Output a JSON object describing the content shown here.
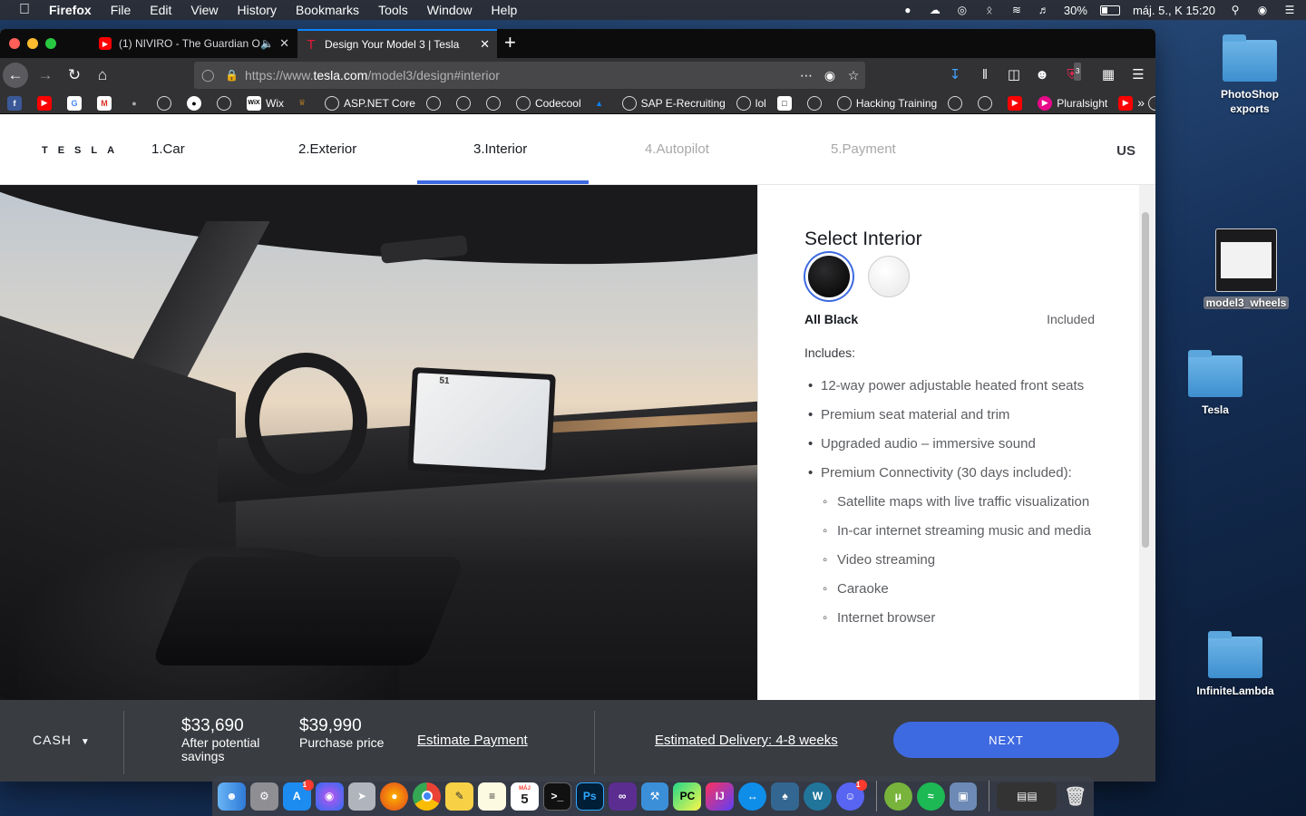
{
  "menubar": {
    "app": "Firefox",
    "menus": [
      "File",
      "Edit",
      "View",
      "History",
      "Bookmarks",
      "Tools",
      "Window",
      "Help"
    ],
    "battery": "30%",
    "datetime": "máj. 5., K  15:20"
  },
  "browser": {
    "tabs": [
      {
        "title": "(1) NIVIRO - The Guardian O",
        "favicon": "youtube-icon",
        "active": false
      },
      {
        "title": "Design Your Model 3 | Tesla",
        "favicon": "tesla-icon",
        "active": true
      }
    ],
    "url_prefix": "https://www.",
    "url_domain": "tesla.com",
    "url_path": "/model3/design#interior",
    "extension_badge": "3",
    "bookmarks": [
      "Wix",
      "ASP.NET Core",
      "Codecool",
      "SAP E-Recruiting",
      "lol",
      "Hacking Training",
      "Pluralsight"
    ]
  },
  "tesla": {
    "logo": "TESLA",
    "steps": [
      {
        "num": "1.",
        "label": "Car"
      },
      {
        "num": "2.",
        "label": "Exterior"
      },
      {
        "num": "3.",
        "label": "Interior"
      },
      {
        "num": "4.",
        "label": "Autopilot"
      },
      {
        "num": "5.",
        "label": "Payment"
      }
    ],
    "active_step": 3,
    "region": "US",
    "photo_speed": "51",
    "interior": {
      "title": "Select Interior",
      "swatches": [
        {
          "name": "All Black",
          "color": "#0b0b0c",
          "selected": true
        },
        {
          "name": "Black and White",
          "color": "#f4f4f4",
          "selected": false
        }
      ],
      "selected_name": "All Black",
      "selected_price": "Included",
      "includes_title": "Includes:",
      "features": [
        "12-way power adjustable heated front seats",
        "Premium seat material and trim",
        "Upgraded audio – immersive sound",
        "Premium Connectivity (30 days included):"
      ],
      "connectivity": [
        "Satellite maps with live traffic visualization",
        "In-car internet streaming music and media",
        "Video streaming",
        "Caraoke",
        "Internet browser"
      ]
    },
    "bottom": {
      "payment_type": "CASH",
      "savings_price": "$33,690",
      "savings_label": "After potential savings",
      "purchase_price": "$39,990",
      "purchase_label": "Purchase price",
      "estimate_link": "Estimate Payment",
      "delivery": "Estimated Delivery: 4-8 weeks",
      "next_label": "NEXT"
    }
  },
  "desktop": {
    "icons": [
      "PhotoShop exports",
      "model3_wheels",
      "Tesla",
      "InfiniteLambda"
    ]
  },
  "dock": {
    "calendar_day": "5",
    "calendar_month": "MÁJ",
    "app_store_badge": "1",
    "discord_badge": "1"
  },
  "colors": {
    "tesla_blue": "#3e6ae1",
    "bottom_bar": "#393c41",
    "firefox_tab_accent": "#0a84ff"
  }
}
